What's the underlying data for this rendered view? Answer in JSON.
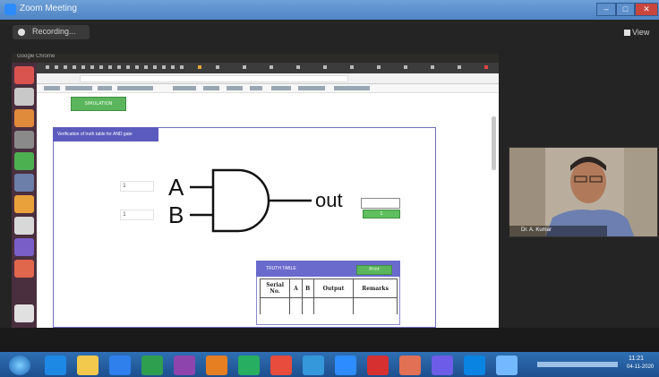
{
  "zoom": {
    "window_title": "Zoom Meeting",
    "recording_label": "Recording...",
    "view_label": "View",
    "min_glyph": "–",
    "max_glyph": "□",
    "close_glyph": "✕"
  },
  "desktop": {
    "top_title": "Google Chrome"
  },
  "browser": {
    "top_button_label": "SIMULATION",
    "sim_header": "Verification of truth table for AND gate"
  },
  "gate": {
    "input_a_letter": "A",
    "input_b_letter": "B",
    "input_a_value": "1",
    "input_b_value": "1",
    "output_label": "out",
    "output_led_label": "1"
  },
  "truth_table": {
    "title": "TRUTH TABLE",
    "button_label": "Print",
    "headers": [
      "Serial No.",
      "A",
      "B",
      "Output",
      "Remarks"
    ]
  },
  "video": {
    "participant_name": "Dr. A. Kumar"
  },
  "taskbar": {
    "time": "11:21",
    "date": "04-11-2020"
  },
  "colors": {
    "zoom_title": "#4f84c4",
    "panel_blue": "#5b5bbd",
    "green_button": "#5bb55c",
    "taskbar": "#1d4f8e"
  }
}
